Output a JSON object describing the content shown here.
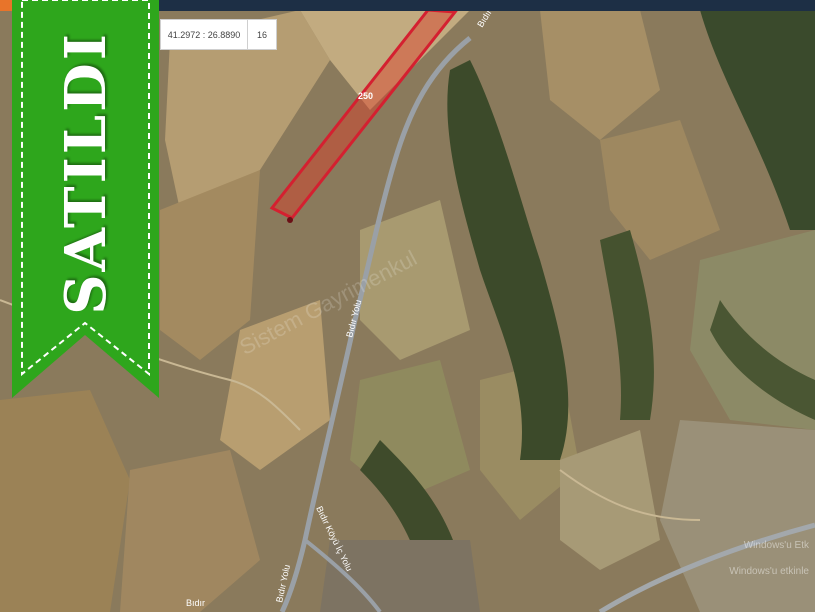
{
  "topbar": {
    "accent_color": "#e8742a",
    "bar_color": "#1d2f45"
  },
  "map": {
    "coordinates": "41.2972 : 26.8890",
    "zoom": "16",
    "parcel_label": "250",
    "parcel_color": "#d42030",
    "road_labels": [
      "Bıdır Yolu",
      "Bıdır Yolu",
      "Bıdır Köyü İç Yolu",
      "Bıdır Yolu",
      "Bıdır"
    ]
  },
  "status_ribbon": {
    "text": "SATILDI",
    "color": "#2ea61c"
  },
  "watermark": {
    "text": "Sistem Gayrimenkul"
  },
  "os_overlay": {
    "line1": "Windows'u Etk",
    "line2": "Windows'u etkinle"
  }
}
